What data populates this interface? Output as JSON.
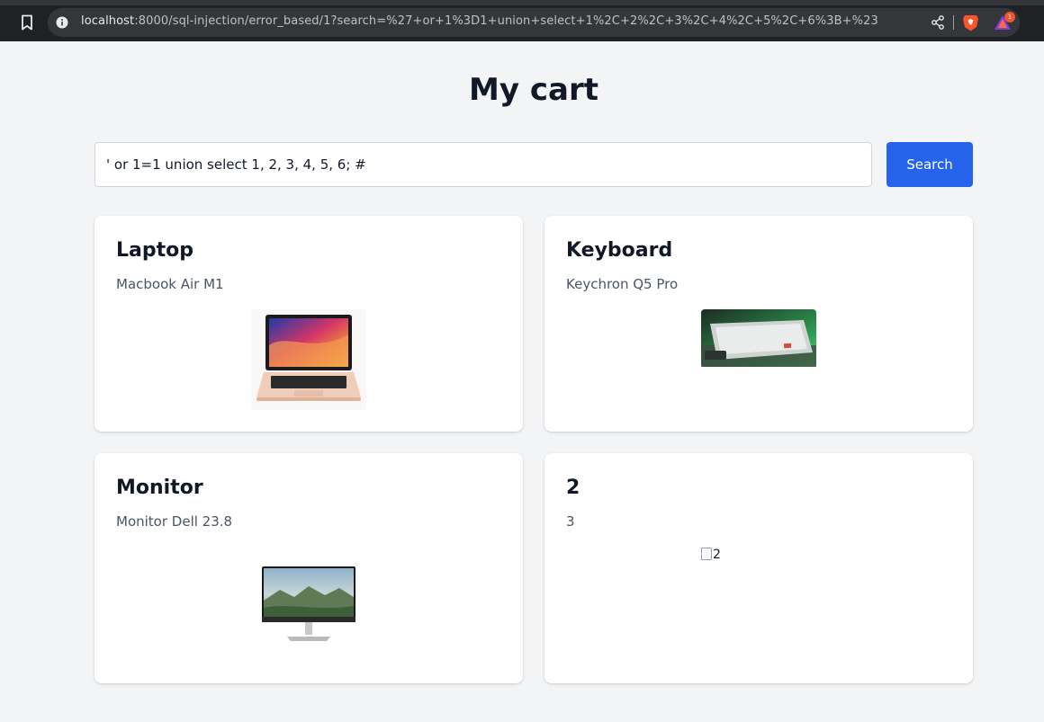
{
  "browser": {
    "url_host": "localhost",
    "url_rest": ":8000/sql-injection/error_based/1?search=%27+or+1%3D1+union+select+1%2C+2%2C+3%2C+4%2C+5%2C+6%3B+%23",
    "rewards_badge_count": "1"
  },
  "page": {
    "title": "My cart"
  },
  "search": {
    "value": "' or 1=1 union select 1, 2, 3, 4, 5, 6; #",
    "button_label": "Search"
  },
  "products": [
    {
      "title": "Laptop",
      "description": "Macbook Air M1"
    },
    {
      "title": "Keyboard",
      "description": "Keychron Q5 Pro"
    },
    {
      "title": "Monitor",
      "description": "Monitor Dell 23.8"
    },
    {
      "title": "2",
      "description": "3",
      "image_alt": "2"
    }
  ],
  "colors": {
    "primary": "#2563eb",
    "background": "#f3f4f6"
  }
}
